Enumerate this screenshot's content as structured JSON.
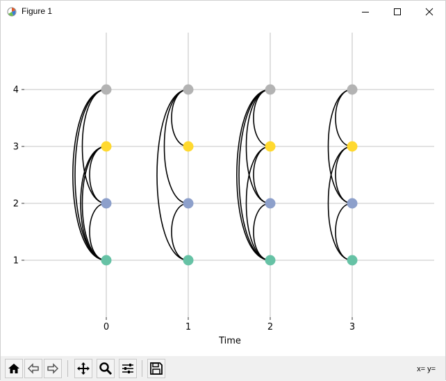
{
  "window": {
    "title": "Figure 1"
  },
  "toolbar": {
    "coords": "x= y="
  },
  "icons": [
    "figure-app-icon",
    "home-icon",
    "back-icon",
    "forward-icon",
    "pan-icon",
    "zoom-icon",
    "configure-icon",
    "save-icon",
    "minimize-icon",
    "maximize-icon",
    "close-icon"
  ],
  "colors": {
    "node_1": "#66c2a5",
    "node_2": "#8da0cb",
    "node_3": "#ffd92f",
    "node_4": "#b3b3b3",
    "edge": "#000000",
    "grid": "#b0b0b0"
  },
  "chart_data": {
    "type": "scatter",
    "title": "",
    "xlabel": "Time",
    "ylabel": "",
    "x_ticks": [
      "0",
      "1",
      "2",
      "3"
    ],
    "y_ticks": [
      "1",
      "2",
      "3",
      "4"
    ],
    "xlim": [
      -1,
      4
    ],
    "ylim": [
      0,
      5
    ],
    "grid": true,
    "nodes": [
      {
        "x": 0,
        "y": 1
      },
      {
        "x": 0,
        "y": 2
      },
      {
        "x": 0,
        "y": 3
      },
      {
        "x": 0,
        "y": 4
      },
      {
        "x": 1,
        "y": 1
      },
      {
        "x": 1,
        "y": 2
      },
      {
        "x": 1,
        "y": 3
      },
      {
        "x": 1,
        "y": 4
      },
      {
        "x": 2,
        "y": 1
      },
      {
        "x": 2,
        "y": 2
      },
      {
        "x": 2,
        "y": 3
      },
      {
        "x": 2,
        "y": 4
      },
      {
        "x": 3,
        "y": 1
      },
      {
        "x": 3,
        "y": 2
      },
      {
        "x": 3,
        "y": 3
      },
      {
        "x": 3,
        "y": 4
      }
    ],
    "edges": [
      {
        "t": 0,
        "a": 1,
        "b": 2
      },
      {
        "t": 0,
        "a": 1,
        "b": 3
      },
      {
        "t": 0,
        "a": 1,
        "b": 4
      },
      {
        "t": 0,
        "a": 2,
        "b": 3
      },
      {
        "t": 0,
        "a": 2,
        "b": 4
      },
      {
        "t": 0,
        "a": 1,
        "b": 3
      },
      {
        "t": 0,
        "a": 1,
        "b": 4
      },
      {
        "t": 1,
        "a": 1,
        "b": 2
      },
      {
        "t": 1,
        "a": 1,
        "b": 4
      },
      {
        "t": 1,
        "a": 2,
        "b": 4
      },
      {
        "t": 1,
        "a": 3,
        "b": 4
      },
      {
        "t": 2,
        "a": 1,
        "b": 2
      },
      {
        "t": 2,
        "a": 1,
        "b": 3
      },
      {
        "t": 2,
        "a": 1,
        "b": 4
      },
      {
        "t": 2,
        "a": 2,
        "b": 3
      },
      {
        "t": 2,
        "a": 2,
        "b": 4
      },
      {
        "t": 2,
        "a": 3,
        "b": 4
      },
      {
        "t": 2,
        "a": 1,
        "b": 4
      },
      {
        "t": 3,
        "a": 1,
        "b": 2
      },
      {
        "t": 3,
        "a": 1,
        "b": 3
      },
      {
        "t": 3,
        "a": 2,
        "b": 3
      },
      {
        "t": 3,
        "a": 2,
        "b": 4
      },
      {
        "t": 3,
        "a": 3,
        "b": 4
      }
    ]
  }
}
